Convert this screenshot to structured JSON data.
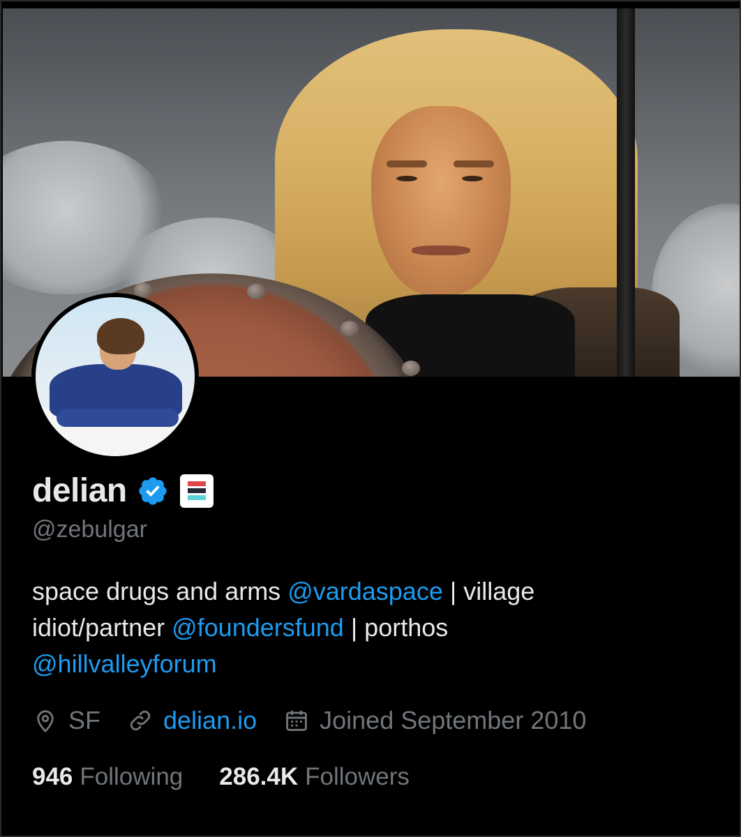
{
  "profile": {
    "display_name": "delian",
    "handle": "@zebulgar",
    "verified_icon": "verified-badge-icon",
    "affiliation_icon": "vardaspace-affiliation-icon",
    "bio": {
      "line1_text1": "space drugs and arms ",
      "line1_mention": "@vardaspace",
      "line1_text2": " | village",
      "line2_text1": "idiot/partner ",
      "line2_mention": "@foundersfund",
      "line2_text2": " | porthos",
      "line3_mention": "@hillvalleyforum"
    },
    "meta": {
      "location": "SF",
      "website": "delian.io",
      "joined": "Joined September 2010"
    },
    "stats": {
      "following_count": "946",
      "following_label": "Following",
      "followers_count": "286.4K",
      "followers_label": "Followers"
    }
  },
  "colors": {
    "background": "#000000",
    "text_primary": "#e7e9ea",
    "text_secondary": "#71767b",
    "accent": "#1d9bf0"
  }
}
